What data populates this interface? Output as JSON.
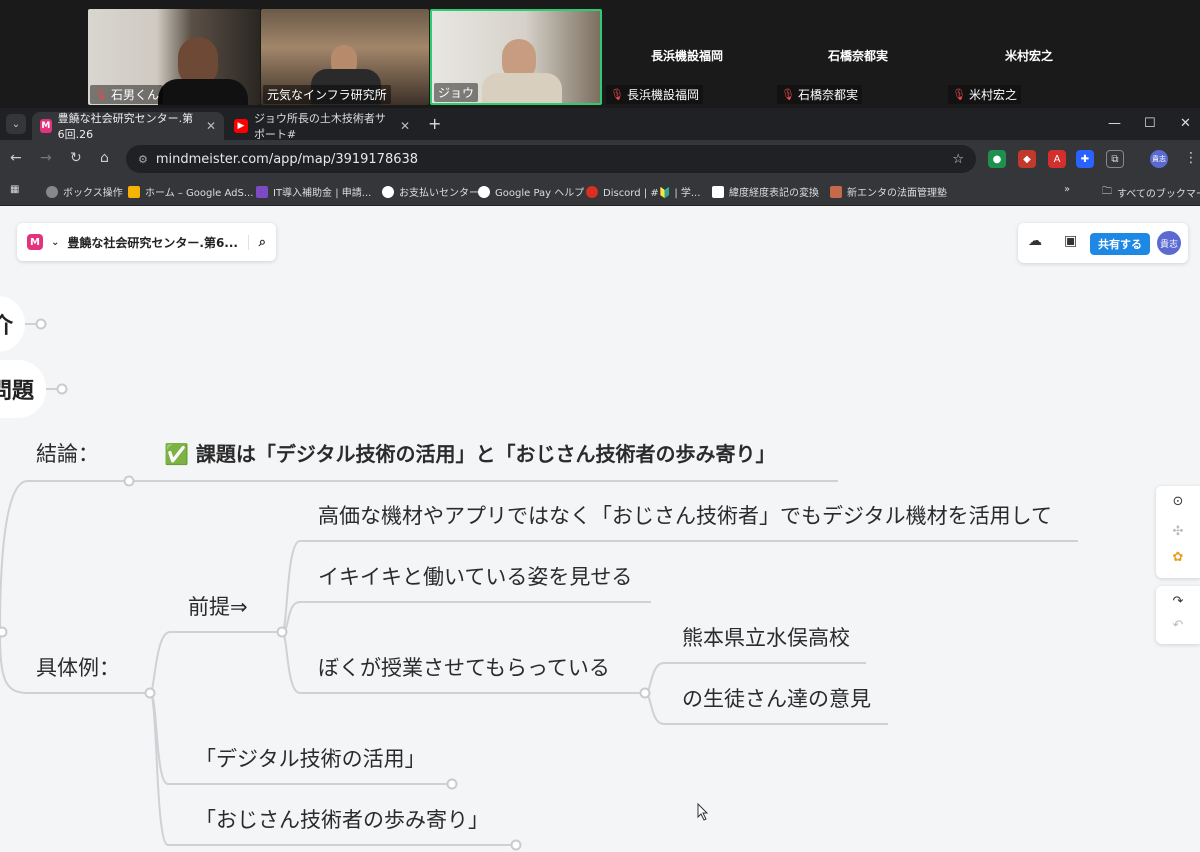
{
  "meeting": {
    "video_tiles": [
      {
        "name": "石男くん"
      },
      {
        "name": "元気なインフラ研究所"
      },
      {
        "name": "ジョウ"
      }
    ],
    "participants": [
      {
        "big": "長浜機設福岡",
        "small": "長浜機設福岡"
      },
      {
        "big": "石橋奈都実",
        "small": "石橋奈都実"
      },
      {
        "big": "米村宏之",
        "small": "米村宏之"
      }
    ]
  },
  "browser": {
    "tabs": [
      {
        "title": "豊饒な社会研究センター.第6回.26"
      },
      {
        "title": "ジョウ所長の土木技術者サポート#"
      }
    ],
    "new_tab": "+",
    "url": "mindmeister.com/app/map/3919178638",
    "bookmarks": [
      "ボックス操作",
      "ホーム – Google AdS...",
      "IT導入補助金 | 申請...",
      "お支払いセンター",
      "Google Pay ヘルプ",
      "Discord | #🔰 | 学...",
      "緯度経度表記の変換",
      "新エンタの法面管理塾"
    ],
    "bookmarks_more": "»",
    "all_bookmarks": "すべてのブックマーク",
    "profile_initials": "貴志"
  },
  "app": {
    "map_title": "豊饒な社会研究センター.第6...",
    "share_label": "共有する",
    "avatar_initials": "貴志"
  },
  "mindmap": {
    "partial_nodes": [
      "介",
      "問題"
    ],
    "conclusion_label": "結論：",
    "conclusion_check": "✅",
    "conclusion_text": "課題は「デジタル技術の活用」と「おじさん技術者の歩み寄り」",
    "example_label": "具体例：",
    "premise_label": "前提⇒",
    "premise_items": [
      "高価な機材やアプリではなく「おじさん技術者」でもデジタル機材を活用して",
      "イキイキと働いている姿を見せる",
      "ぼくが授業させてもらっている"
    ],
    "class_items": [
      "熊本県立水俣高校",
      "の生徒さん達の意見"
    ],
    "topics": [
      "「デジタル技術の活用」",
      "「おじさん技術者の歩み寄り」"
    ]
  }
}
